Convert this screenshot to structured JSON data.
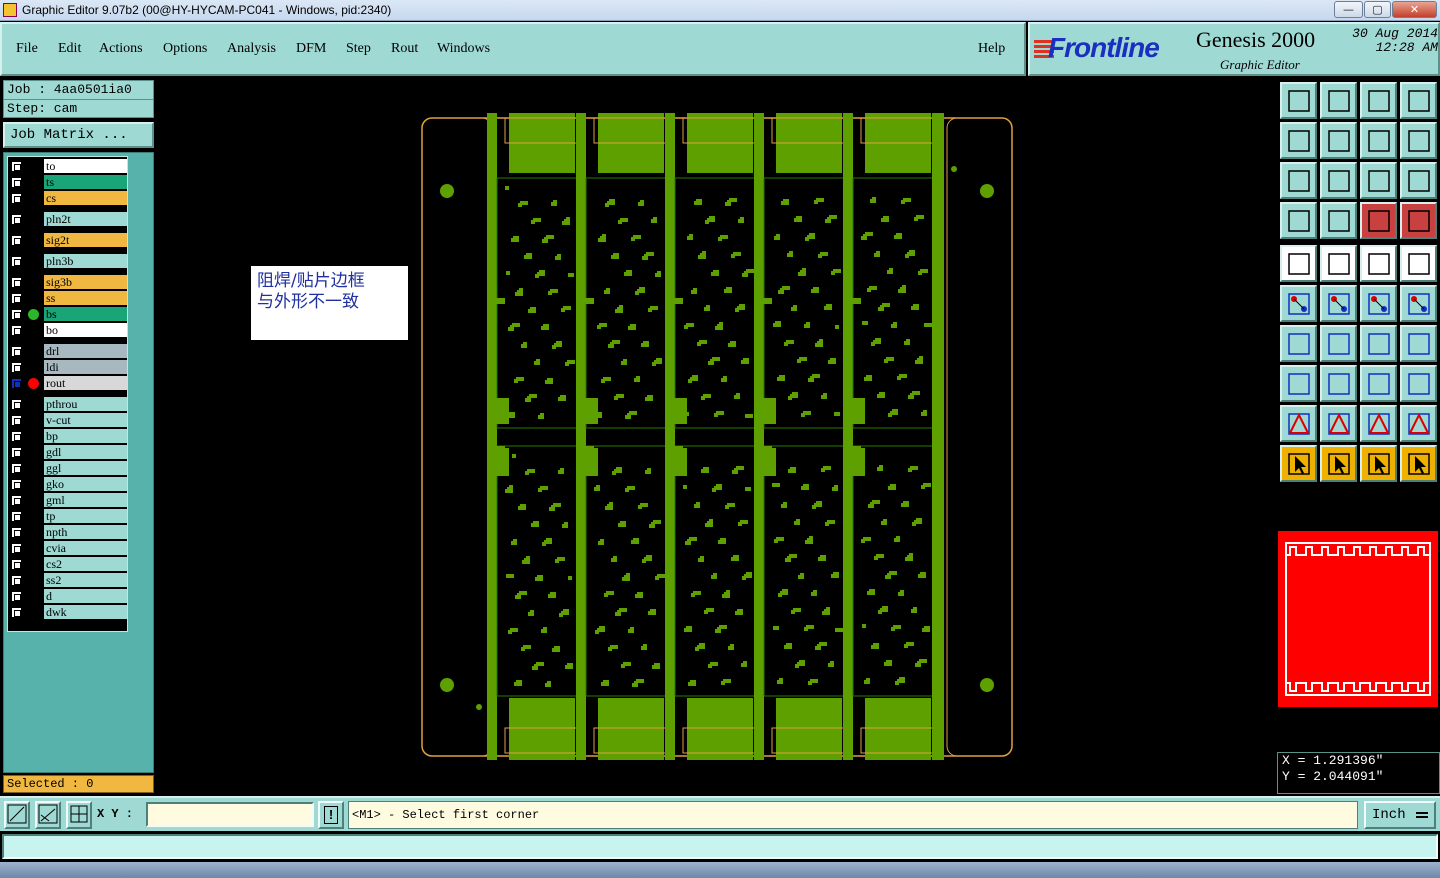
{
  "window": {
    "title": "Graphic Editor 9.07b2 (00@HY-HYCAM-PC041 - Windows, pid:2340)",
    "minimize": "—",
    "maximize": "▢",
    "close": "✕"
  },
  "menu": {
    "items": [
      "File",
      "Edit",
      "Actions",
      "Options",
      "Analysis",
      "DFM",
      "Step",
      "Rout",
      "Windows"
    ],
    "help": "Help"
  },
  "branding": {
    "logo": "Frontline",
    "product": "Genesis 2000",
    "subtitle": "Graphic Editor",
    "date": "30 Aug 2014",
    "time": "12:28 AM"
  },
  "job": {
    "job_line": "Job : 4aa0501ia0",
    "step_line": "Step: cam",
    "matrix_button": "Job Matrix ..."
  },
  "layers": [
    {
      "name": "to",
      "color": "#ffffff"
    },
    {
      "name": "ts",
      "color": "#1aa578"
    },
    {
      "name": "cs",
      "color": "#f0b840"
    },
    {
      "name": "pln2t",
      "color": "#9fd9d3"
    },
    {
      "name": "sig2t",
      "color": "#f0b840"
    },
    {
      "name": "pln3b",
      "color": "#9fd9d3"
    },
    {
      "name": "sig3b",
      "color": "#f0b840"
    },
    {
      "name": "ss",
      "color": "#f0b840"
    },
    {
      "name": "bs",
      "color": "#1aa578"
    },
    {
      "name": "bo",
      "color": "#ffffff"
    },
    {
      "name": "drl",
      "color": "#a8b8c0"
    },
    {
      "name": "ldi",
      "color": "#a8b8c0"
    },
    {
      "name": "rout",
      "color": "#d8d8d8"
    },
    {
      "name": "pthrou",
      "color": "#9fd9d3"
    },
    {
      "name": "v-cut",
      "color": "#9fd9d3"
    },
    {
      "name": "bp",
      "color": "#9fd9d3"
    },
    {
      "name": "gdl",
      "color": "#9fd9d3"
    },
    {
      "name": "ggl",
      "color": "#9fd9d3"
    },
    {
      "name": "gko",
      "color": "#9fd9d3"
    },
    {
      "name": "gml",
      "color": "#9fd9d3"
    },
    {
      "name": "tp",
      "color": "#9fd9d3"
    },
    {
      "name": "npth",
      "color": "#9fd9d3"
    },
    {
      "name": "cvia",
      "color": "#9fd9d3"
    },
    {
      "name": "cs2",
      "color": "#9fd9d3"
    },
    {
      "name": "ss2",
      "color": "#9fd9d3"
    },
    {
      "name": "d",
      "color": "#9fd9d3"
    },
    {
      "name": "dwk",
      "color": "#9fd9d3"
    }
  ],
  "active_layer": "bs",
  "work_layer": "rout",
  "selected": "Selected : 0",
  "note": {
    "line1": "阻焊/贴片边框",
    "line2": "与外形不一致"
  },
  "coords": {
    "x": "X = 1.291396\"",
    "y": "Y = 2.044091\""
  },
  "bottom": {
    "xy_label": "X Y :",
    "xy_value": "",
    "prompt": "<M1> - Select first corner",
    "unit": "Inch",
    "alert_icon": "!"
  },
  "colors": {
    "panel": "#9fd9d3",
    "board_green": "#5ea000",
    "board_outline": "#e0a040",
    "overview_bg": "#ff0000"
  }
}
